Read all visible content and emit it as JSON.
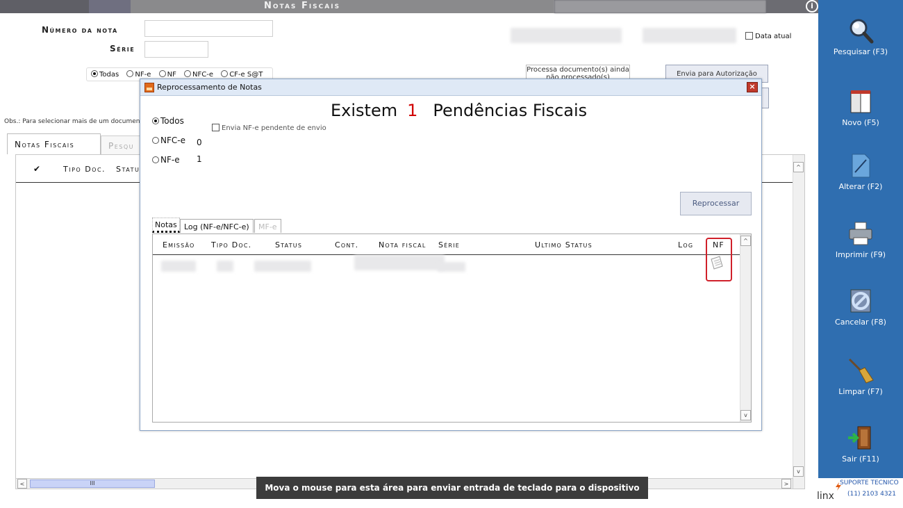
{
  "window": {
    "title": "Notas Fiscais",
    "info_glyph": "i",
    "close_glyph": "×"
  },
  "form": {
    "numero_label": "Número da nota",
    "serie_label": "Série",
    "data_atual_label": "Data atual",
    "filter_options": [
      "Todas",
      "NF-e",
      "NF",
      "NFC-e",
      "CF-e S@T"
    ],
    "filter_selected": "Todas",
    "processa_button": "Processa documento(s) ainda não processado(s)",
    "envia_button": "Envia para Autorização SEFAZ",
    "obs_text": "Obs.: Para selecionar mais de um documen"
  },
  "tabs": {
    "main_tab": "Notas Fiscais",
    "second_tab": "Pesqu"
  },
  "grid": {
    "columns": [
      "✔",
      "Tipo Doc.",
      "Status"
    ]
  },
  "scroll": {
    "up": "^",
    "down": "v",
    "left": "<",
    "right": ">",
    "thumb": "III"
  },
  "toolbar": {
    "items": [
      {
        "label": "Pesquisar (F3)",
        "icon": "magnifier-icon"
      },
      {
        "label": "Novo (F5)",
        "icon": "new-document-icon"
      },
      {
        "label": "Alterar (F2)",
        "icon": "edit-icon"
      },
      {
        "label": "Imprimir (F9)",
        "icon": "printer-icon"
      },
      {
        "label": "Cancelar (F8)",
        "icon": "cancel-icon"
      },
      {
        "label": "Limpar (F7)",
        "icon": "broom-icon"
      },
      {
        "label": "Sair (F11)",
        "icon": "exit-door-icon"
      }
    ]
  },
  "support": {
    "brand": "linx",
    "label": "SUPORTE TECNICO",
    "phone": "(11) 2103 4321"
  },
  "dialog": {
    "title": "Reprocessamento de Notas",
    "headline_prefix": "Existem",
    "pending_count": "1",
    "headline_suffix": "Pendências Fiscais",
    "radios": [
      {
        "label": "Todos",
        "selected": true,
        "count": ""
      },
      {
        "label": "NFC-e",
        "selected": false,
        "count": "0"
      },
      {
        "label": "NF-e",
        "selected": false,
        "count": "1"
      }
    ],
    "envia_pendente_label": "Envia NF-e pendente de envio",
    "reprocessar_button": "Reprocessar",
    "tabs": [
      "Notas",
      "Log (NF-e/NFC-e)",
      "MF-e"
    ],
    "columns": [
      "Emissão",
      "Tipo Doc.",
      "Status",
      "Cont.",
      "Nota fiscal",
      "Série",
      "Ultimo Status",
      "Log",
      "NF"
    ]
  },
  "tooltip": "Mova o mouse para esta área para enviar entrada de teclado para o dispositivo remoto",
  "colors": {
    "sidebar": "#2f6eb0",
    "pending_count": "#d10000",
    "highlight": "#d0202a"
  }
}
